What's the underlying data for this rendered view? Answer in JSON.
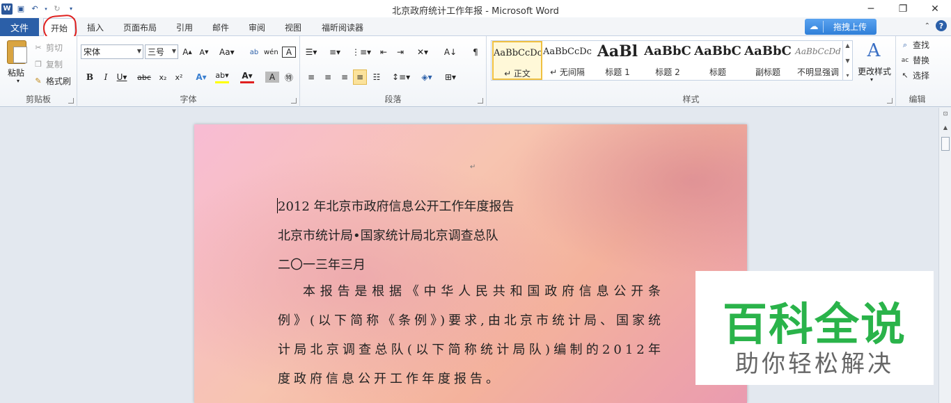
{
  "window": {
    "title": "北京政府统计工作年报 - Microsoft Word",
    "minimize_label": "─",
    "restore_label": "❐",
    "close_label": "✕"
  },
  "tabs": {
    "file": "文件",
    "items": [
      "开始",
      "插入",
      "页面布局",
      "引用",
      "邮件",
      "审阅",
      "视图",
      "福昕阅读器"
    ],
    "active": "开始",
    "upload_button": "拖拽上传"
  },
  "clipboard": {
    "paste": "粘贴",
    "cut": "剪切",
    "copy": "复制",
    "format_painter": "格式刷",
    "label": "剪贴板"
  },
  "font": {
    "name": "宋体",
    "size": "三号",
    "label": "字体"
  },
  "paragraph": {
    "label": "段落"
  },
  "styles": {
    "label": "样式",
    "change_styles": "更改样式",
    "items": [
      {
        "sample": "AaBbCcDc",
        "name": "↵ 正文"
      },
      {
        "sample": "AaBbCcDc",
        "name": "↵ 无间隔"
      },
      {
        "sample": "AaBl",
        "name": "标题 1"
      },
      {
        "sample": "AaBbC",
        "name": "标题 2"
      },
      {
        "sample": "AaBbC",
        "name": "标题"
      },
      {
        "sample": "AaBbC",
        "name": "副标题"
      },
      {
        "sample": "AaBbCcDd",
        "name": "不明显强调"
      }
    ]
  },
  "editing": {
    "find": "查找",
    "replace": "替换",
    "select": "选择",
    "label": "编辑"
  },
  "document": {
    "line1": "2012 年北京市政府信息公开工作年度报告",
    "line2": "北京市统计局•国家统计局北京调查总队",
    "line3": "二〇一三年三月",
    "para1": "本报告是根据《中华人民共和国政府信息公开条例》(以下简称《条例》)要求,由北京市统计局、国家统计局北京调查总队(以下简称统计局队)编制的2012年度政府信息公开工作年度报告。"
  },
  "watermark": {
    "title": "百科全说",
    "subtitle": "助你轻松解决"
  }
}
